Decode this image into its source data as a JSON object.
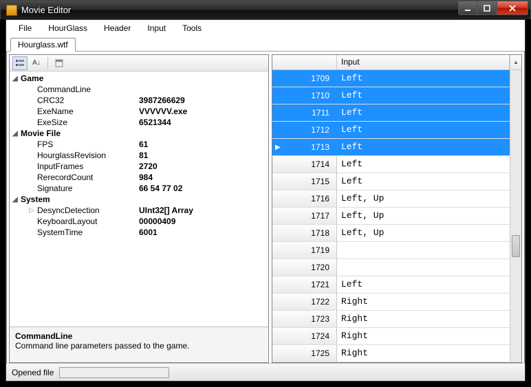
{
  "window": {
    "title": "Movie Editor"
  },
  "menu": {
    "file": "File",
    "hourglass": "HourGlass",
    "header": "Header",
    "input": "Input",
    "tools": "Tools"
  },
  "tab": {
    "label": "Hourglass.wtf"
  },
  "properties": {
    "categories": [
      {
        "name": "Game",
        "rows": [
          {
            "name": "CommandLine",
            "value": ""
          },
          {
            "name": "CRC32",
            "value": "3987266629"
          },
          {
            "name": "ExeName",
            "value": "VVVVVV.exe"
          },
          {
            "name": "ExeSize",
            "value": "6521344"
          }
        ]
      },
      {
        "name": "Movie File",
        "rows": [
          {
            "name": "FPS",
            "value": "61"
          },
          {
            "name": "HourglassRevision",
            "value": "81"
          },
          {
            "name": "InputFrames",
            "value": "2720"
          },
          {
            "name": "RerecordCount",
            "value": "984"
          },
          {
            "name": "Signature",
            "value": "66 54 77 02"
          }
        ]
      },
      {
        "name": "System",
        "rows": [
          {
            "name": "DesyncDetection",
            "value": "UInt32[] Array",
            "expandable": true
          },
          {
            "name": "KeyboardLayout",
            "value": "00000409"
          },
          {
            "name": "SystemTime",
            "value": "6001"
          }
        ]
      }
    ]
  },
  "help": {
    "name": "CommandLine",
    "desc": "Command line parameters passed to the game."
  },
  "grid": {
    "header": "Input",
    "rows": [
      {
        "frame": "1709",
        "input": "Left",
        "selected": true
      },
      {
        "frame": "1710",
        "input": "Left",
        "selected": true
      },
      {
        "frame": "1711",
        "input": "Left",
        "selected": true
      },
      {
        "frame": "1712",
        "input": "Left",
        "selected": true
      },
      {
        "frame": "1713",
        "input": "Left",
        "selected": true,
        "current": true
      },
      {
        "frame": "1714",
        "input": "Left"
      },
      {
        "frame": "1715",
        "input": "Left"
      },
      {
        "frame": "1716",
        "input": "Left, Up"
      },
      {
        "frame": "1717",
        "input": "Left, Up"
      },
      {
        "frame": "1718",
        "input": "Left, Up"
      },
      {
        "frame": "1719",
        "input": ""
      },
      {
        "frame": "1720",
        "input": ""
      },
      {
        "frame": "1721",
        "input": "Left"
      },
      {
        "frame": "1722",
        "input": "Right"
      },
      {
        "frame": "1723",
        "input": "Right"
      },
      {
        "frame": "1724",
        "input": "Right"
      },
      {
        "frame": "1725",
        "input": "Right"
      }
    ]
  },
  "status": {
    "text": "Opened file"
  }
}
